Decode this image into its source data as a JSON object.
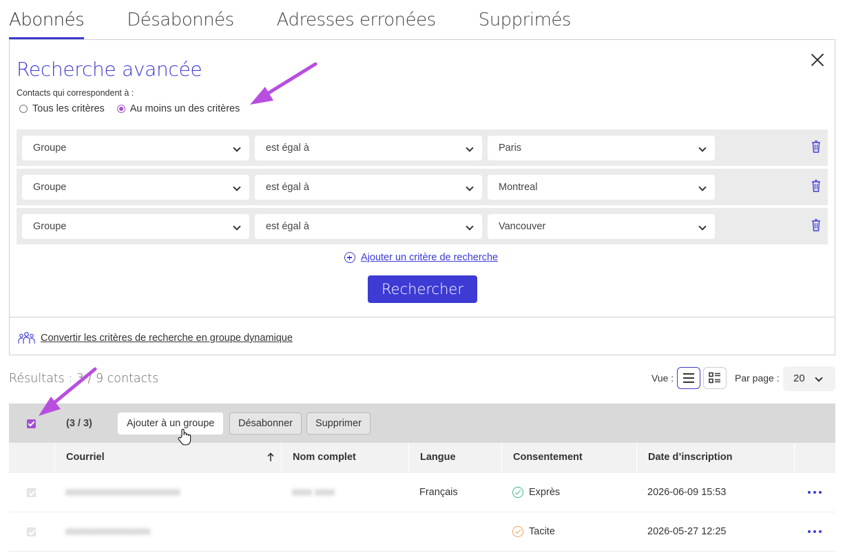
{
  "tabs": [
    {
      "label": "Abonnés",
      "active": true
    },
    {
      "label": "Désabonnés"
    },
    {
      "label": "Adresses erronées"
    },
    {
      "label": "Supprimés"
    }
  ],
  "search": {
    "title": "Recherche avancée",
    "match_label": "Contacts qui correspondent à :",
    "radio_all": "Tous les critères",
    "radio_any": "Au moins un des critères",
    "selected": "any",
    "criteria": [
      {
        "field": "Groupe",
        "operator": "est égal à",
        "value": "Paris"
      },
      {
        "field": "Groupe",
        "operator": "est égal à",
        "value": "Montreal"
      },
      {
        "field": "Groupe",
        "operator": "est égal à",
        "value": "Vancouver"
      }
    ],
    "add_criterion": "Ajouter un critère de recherche",
    "search_button": "Rechercher",
    "convert_link": "Convertir les critères de recherche en groupe dynamique"
  },
  "results": {
    "summary": "Résultats : 3 / 9 contacts",
    "view_label": "Vue :",
    "per_page_label": "Par page :",
    "per_page_value": "20"
  },
  "bulk": {
    "count": "(3 / 3)",
    "add_group": "Ajouter à un groupe",
    "unsubscribe": "Désabonner",
    "delete": "Supprimer"
  },
  "table": {
    "columns": [
      "Courriel",
      "Nom complet",
      "Langue",
      "Consentement",
      "Date d’inscription"
    ],
    "rows": [
      {
        "email": "xxxxxxxxxxxxxxxxxxxxxxx",
        "name": "xxxx xxxx",
        "language": "Français",
        "consent": "Exprès",
        "consent_type": "express",
        "date": "2026-06-09 15:53"
      },
      {
        "email": "xxxxxxxxxxxxxxxxx",
        "name": "",
        "language": "",
        "consent": "Tacite",
        "consent_type": "tacit",
        "date": "2026-05-27 12:25"
      }
    ]
  },
  "colors": {
    "accent": "#3d3bd4",
    "checkbox": "#a64fd1",
    "arrow": "#b84ee0"
  }
}
